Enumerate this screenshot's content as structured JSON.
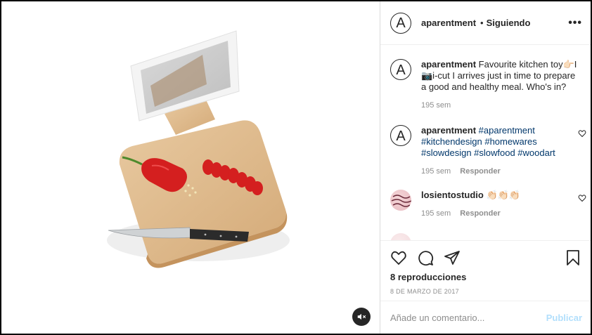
{
  "post": {
    "username": "aparentment",
    "separator": "•",
    "follow_status": "Siguiendo",
    "more": "•••",
    "avatar_letter": "A"
  },
  "comments": [
    {
      "username": "aparentment",
      "text": "Favourite kitchen toy👉🏻I 📷i-cut I arrives just in time to prepare a good and healthy meal. Who's in?",
      "time": "195 sem",
      "reply": ""
    },
    {
      "username": "aparentment",
      "hashtags": "#aparentment #kitchendesign #homewares #slowdesign #slowfood #woodart",
      "time": "195 sem",
      "reply": "Responder"
    },
    {
      "username": "losientostudio",
      "text": "👏🏻👏🏻👏🏻",
      "time": "195 sem",
      "reply": "Responder"
    }
  ],
  "actions": {
    "views": "8 reproducciones",
    "date": "8 DE MARZO DE 2017"
  },
  "composer": {
    "placeholder": "Añade un comentario...",
    "publish": "Publicar"
  }
}
